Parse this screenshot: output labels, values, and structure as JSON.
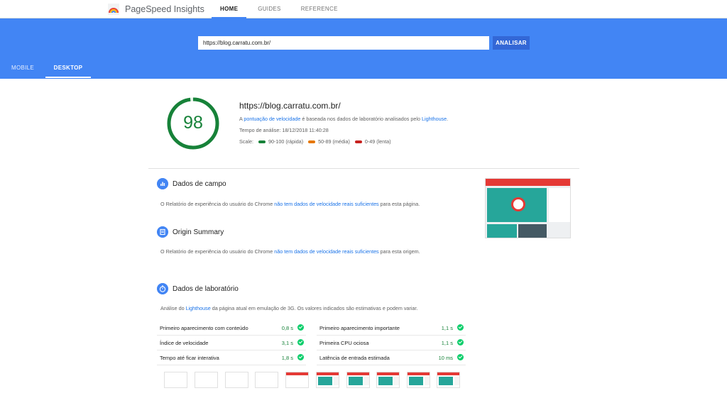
{
  "app": {
    "title": "PageSpeed Insights"
  },
  "nav": {
    "items": [
      "HOME",
      "GUIDES",
      "REFERENCE"
    ]
  },
  "search": {
    "url_value": "https://blog.carratu.com.br/",
    "button_label": "ANALISAR"
  },
  "device_tabs": [
    "MOBILE",
    "DESKTOP"
  ],
  "summary": {
    "score": "98",
    "url": "https://blog.carratu.com.br/",
    "desc_prefix": "A ",
    "desc_link1": "pontuação de velocidade",
    "desc_middle": " é baseada nos dados de laboratório analisados pelo ",
    "desc_link2": "Lighthouse",
    "desc_suffix": ".",
    "analysis_time": "Tempo de análise: 18/12/2018 11:40:28",
    "scale_label": "Scale:",
    "scale_fast": "90-100 (rápida)",
    "scale_average": "50-89 (média)",
    "scale_slow": "0-49 (lenta)"
  },
  "field_data": {
    "title": "Dados de campo",
    "desc_prefix": "O Relatório de experiência do usuário do Chrome ",
    "desc_link": "não tem dados de velocidade reais suficientes",
    "desc_suffix": " para esta página."
  },
  "origin_summary": {
    "title": "Origin Summary",
    "desc_prefix": "O Relatório de experiência do usuário do Chrome ",
    "desc_link": "não tem dados de velocidade reais suficientes",
    "desc_suffix": " para esta origem."
  },
  "lab_data": {
    "title": "Dados de laboratório",
    "desc_prefix": "Análise do ",
    "desc_link": "Lighthouse",
    "desc_suffix": " da página atual em emulação de 3G. Os valores indicados são estimativas e podem variar.",
    "metrics": [
      {
        "label": "Primeiro aparecimento com conteúdo",
        "value": "0,8 s"
      },
      {
        "label": "Primeiro aparecimento importante",
        "value": "1,1 s"
      },
      {
        "label": "Índice de velocidade",
        "value": "3,1 s"
      },
      {
        "label": "Primeira CPU ociosa",
        "value": "1,1 s"
      },
      {
        "label": "Tempo até ficar interativa",
        "value": "1,8 s"
      },
      {
        "label": "Latência de entrada estimada",
        "value": "10 ms"
      }
    ]
  },
  "colors": {
    "fast": "#0cce6b",
    "average": "#ffa400",
    "slow": "#ff4e42",
    "accent": "#4285f4",
    "score_ring": "#178239"
  }
}
